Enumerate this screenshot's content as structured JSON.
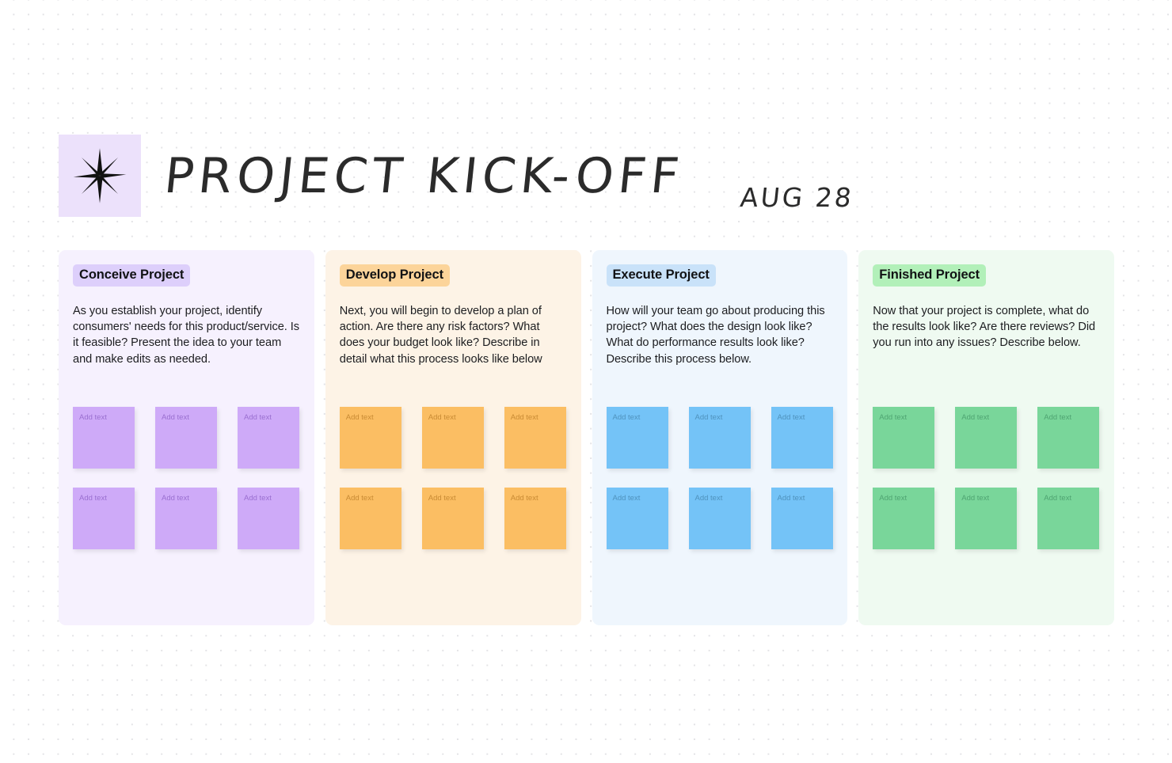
{
  "header": {
    "logo_icon": "sparkle-star-icon",
    "title": "PROJECT KICK-OFF",
    "date": "AUG 28"
  },
  "note_placeholder": "Add text",
  "columns": [
    {
      "id": "conceive",
      "heading": "Conceive Project",
      "description": "As you establish your project, identify consumers' needs for this product/service. Is it feasible? Present the idea to your team and make edits as needed.",
      "panel_color": "#f6f1fe",
      "heading_color": "#ddcffb",
      "note_color": "#ceaaf8",
      "note_count": 6
    },
    {
      "id": "develop",
      "heading": "Develop Project",
      "description": "Next, you will begin to develop a plan of action. Are there any risk factors? What does your budget look like? Describe in detail what this process looks like below",
      "panel_color": "#fdf3e6",
      "heading_color": "#fcd49a",
      "note_color": "#fbbe63",
      "note_count": 6
    },
    {
      "id": "execute",
      "heading": "Execute Project",
      "description": "How will your team go about producing this project? What does the design look like? What do performance results look like? Describe this process below.",
      "panel_color": "#eff6fd",
      "heading_color": "#c9e2f9",
      "note_color": "#74c3f7",
      "note_count": 6
    },
    {
      "id": "finished",
      "heading": "Finished Project",
      "description": "Now that your project is complete, what do the results look like? Are there reviews? Did you run into any issues? Describe below.",
      "panel_color": "#effaf1",
      "heading_color": "#b2f0b9",
      "note_color": "#79d69a",
      "note_count": 6
    }
  ]
}
